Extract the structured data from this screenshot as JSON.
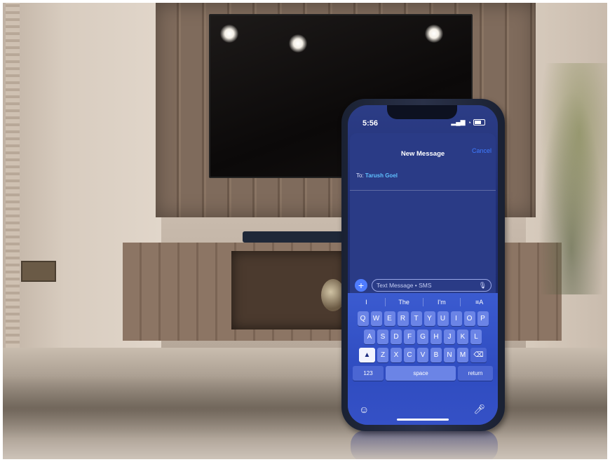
{
  "phone": {
    "status": {
      "time": "5:56"
    },
    "compose": {
      "title": "New Message",
      "cancel_label": "Cancel",
      "to_label": "To:",
      "recipient": "Tarush Goel",
      "placeholder": "Text Message • SMS",
      "plus_icon": "plus-icon",
      "mic_icon": "microphone-icon"
    },
    "suggestions": [
      "I",
      "The",
      "I'm"
    ],
    "keyboard": {
      "row1": [
        "Q",
        "W",
        "E",
        "R",
        "T",
        "Y",
        "U",
        "I",
        "O",
        "P"
      ],
      "row2": [
        "A",
        "S",
        "D",
        "F",
        "G",
        "H",
        "J",
        "K",
        "L"
      ],
      "row3": [
        "Z",
        "X",
        "C",
        "V",
        "B",
        "N",
        "M"
      ],
      "numbers_label": "123",
      "space_label": "space",
      "return_label": "return"
    },
    "accent_color": "#3f7bff"
  }
}
